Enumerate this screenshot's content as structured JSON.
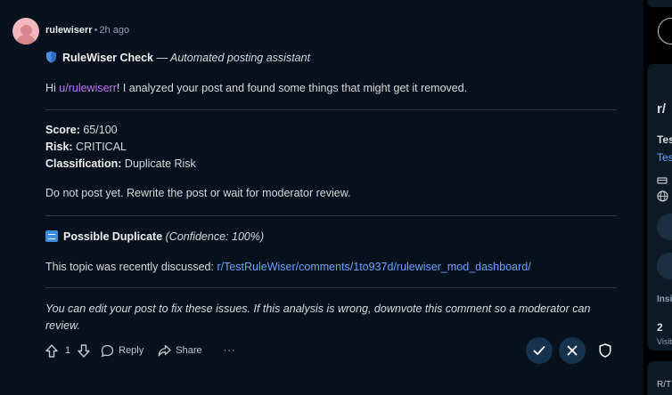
{
  "comment": {
    "username": "rulewiserr",
    "time": "2h ago",
    "bot_name": "RuleWiser Check",
    "bot_tagline": "— Automated posting assistant",
    "intro_prefix": "Hi ",
    "intro_user": "u/rulewiserr",
    "intro_suffix": "! I analyzed your post and found some things that might get it removed.",
    "score_label": "Score:",
    "score_value": " 65/100",
    "risk_label": "Risk:",
    "risk_value": " CRITICAL",
    "class_label": "Classification:",
    "class_value": " Duplicate Risk",
    "advice": "Do not post yet. Rewrite the post or wait for moderator review.",
    "dup_title": "Possible Duplicate",
    "dup_confidence": "(Confidence: 100%)",
    "dup_text_prefix": "This topic was recently discussed: ",
    "dup_link": "r/TestRuleWiser/comments/1to937d/rulewiser_mod_dashboard/",
    "footer_line1": "You can edit your post to fix these issues. If this analysis is wrong, downvote this comment so a moderator can",
    "footer_line2": "review."
  },
  "actions": {
    "vote_count": "1",
    "reply_label": "Reply",
    "share_label": "Share",
    "more_label": "···"
  },
  "sidebar": {
    "heading": "r/",
    "item1": "Tes",
    "item2": "Tes",
    "insights": "Insi",
    "stat": "2",
    "visits": "Visit",
    "footer": "R/T"
  },
  "colors": {
    "background": "#06111d",
    "link_purple": "#c373f0",
    "link_blue": "#6aa4ff",
    "button_bg": "#16324c"
  }
}
